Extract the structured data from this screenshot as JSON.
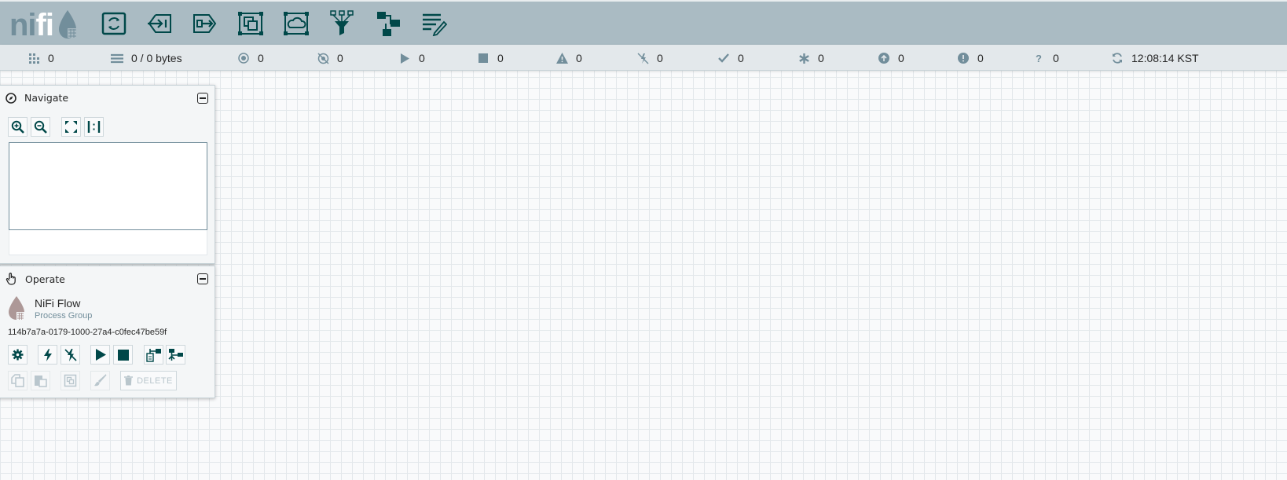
{
  "app": {
    "logo_text_1": "ni",
    "logo_text_2": "fi"
  },
  "toolbar": {
    "items": [
      {
        "name": "processor"
      },
      {
        "name": "input-port"
      },
      {
        "name": "output-port"
      },
      {
        "name": "process-group"
      },
      {
        "name": "remote-process-group"
      },
      {
        "name": "funnel"
      },
      {
        "name": "template"
      },
      {
        "name": "label"
      }
    ],
    "accent_color": "#004849"
  },
  "status": {
    "active_threads": "0",
    "queued": "0 / 0 bytes",
    "transmitting": "0",
    "not_transmitting": "0",
    "running": "0",
    "stopped": "0",
    "invalid": "0",
    "disabled": "0",
    "up_to_date": "0",
    "locally_modified": "0",
    "stale": "0",
    "sync_failure": "0",
    "unknown": "0",
    "refresh_time": "12:08:14 KST"
  },
  "navigate": {
    "title": "Navigate"
  },
  "operate": {
    "title": "Operate",
    "component_name": "NiFi Flow",
    "component_type": "Process Group",
    "component_id": "114b7a7a-0179-1000-27a4-c0fec47be59f",
    "delete_label": "DELETE"
  }
}
